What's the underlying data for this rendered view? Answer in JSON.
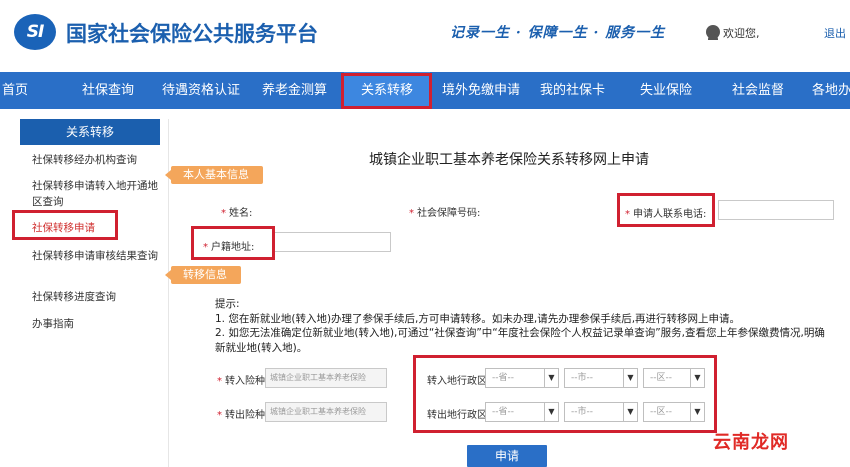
{
  "header": {
    "logo_text": "SI",
    "site_title": "国家社会保险公共服务平台",
    "slogan": "记录一生 · 保障一生 · 服务一生",
    "welcome": "欢迎您,",
    "logout": "退出"
  },
  "nav": {
    "items": [
      "首页",
      "社保查询",
      "待遇资格认证",
      "养老金测算",
      "关系转移",
      "境外免缴申请",
      "我的社保卡",
      "失业保险",
      "社会监督",
      "各地办"
    ],
    "active_index": 4
  },
  "sidebar": {
    "heading": "关系转移",
    "items": [
      "社保转移经办机构查询",
      "社保转移申请转入地开通地区查询",
      "社保转移申请",
      "社保转移申请审核结果查询",
      "社保转移进度查询",
      "办事指南"
    ],
    "active_index": 2
  },
  "form": {
    "title": "城镇企业职工基本养老保险关系转移网上申请",
    "section_basic": "本人基本信息",
    "section_transfer": "转移信息",
    "required_mark": "*",
    "name_label": "姓名:",
    "ssn_label": "社会保障号码:",
    "phone_label": "申请人联系电话:",
    "hukou_label": "户籍地址:",
    "tips_title": "提示:",
    "tip1": "1. 您在新就业地(转入地)办理了参保手续后,方可申请转移。如未办理,请先办理参保手续后,再进行转移网上申请。",
    "tip2": "2. 如您无法准确定位新就业地(转入地),可通过“社保查询”中“年度社会保险个人权益记录单查询”服务,查看您上年参保缴费情况,明确新就业地(转入地)。",
    "in_type_label": "转入险种",
    "out_type_label": "转出险种",
    "insurance_value": "城镇企业职工基本养老保险",
    "in_region_label": "转入地行政区",
    "out_region_label": "转出地行政区",
    "province_placeholder": "--省--",
    "city_placeholder": "--市--",
    "district_placeholder": "--区--",
    "submit_label": "申请"
  },
  "watermark": "云南龙网",
  "colors": {
    "brand_blue": "#2a6fc7",
    "highlight_red": "#d02030",
    "tag_orange": "#f4a65b"
  }
}
